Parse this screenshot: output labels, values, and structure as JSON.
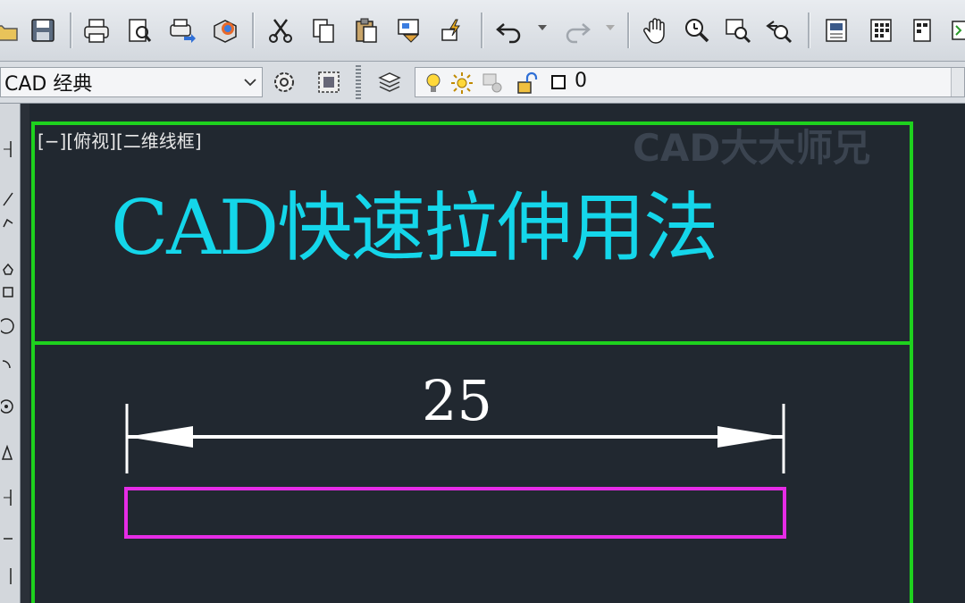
{
  "app": {
    "workspace": "CAD 经典",
    "layer_name": "0"
  },
  "toolbar": {
    "buttons": [
      "open-icon",
      "save-icon",
      "print-icon",
      "print-preview-icon",
      "publish-icon",
      "3d-dwf-icon",
      "cut-icon",
      "copy-icon",
      "paste-icon",
      "match-properties-icon",
      "block-editor-icon",
      "undo-icon",
      "redo-icon",
      "pan-icon",
      "zoom-realtime-icon",
      "zoom-window-icon",
      "zoom-previous-icon",
      "properties-icon",
      "design-center-icon",
      "tool-palettes-icon",
      "sheet-set-icon"
    ]
  },
  "viewport": {
    "label": "[−][俯视][二维线框]",
    "watermark": "CAD大大师兄"
  },
  "drawing": {
    "title": "CAD快速拉伸用法",
    "dimension_value": "25",
    "colors": {
      "frame": "#1ed21e",
      "title": "#14d6ea",
      "dimension": "#ffffff",
      "rectangle": "#e62ce6",
      "background": "#212830"
    }
  }
}
